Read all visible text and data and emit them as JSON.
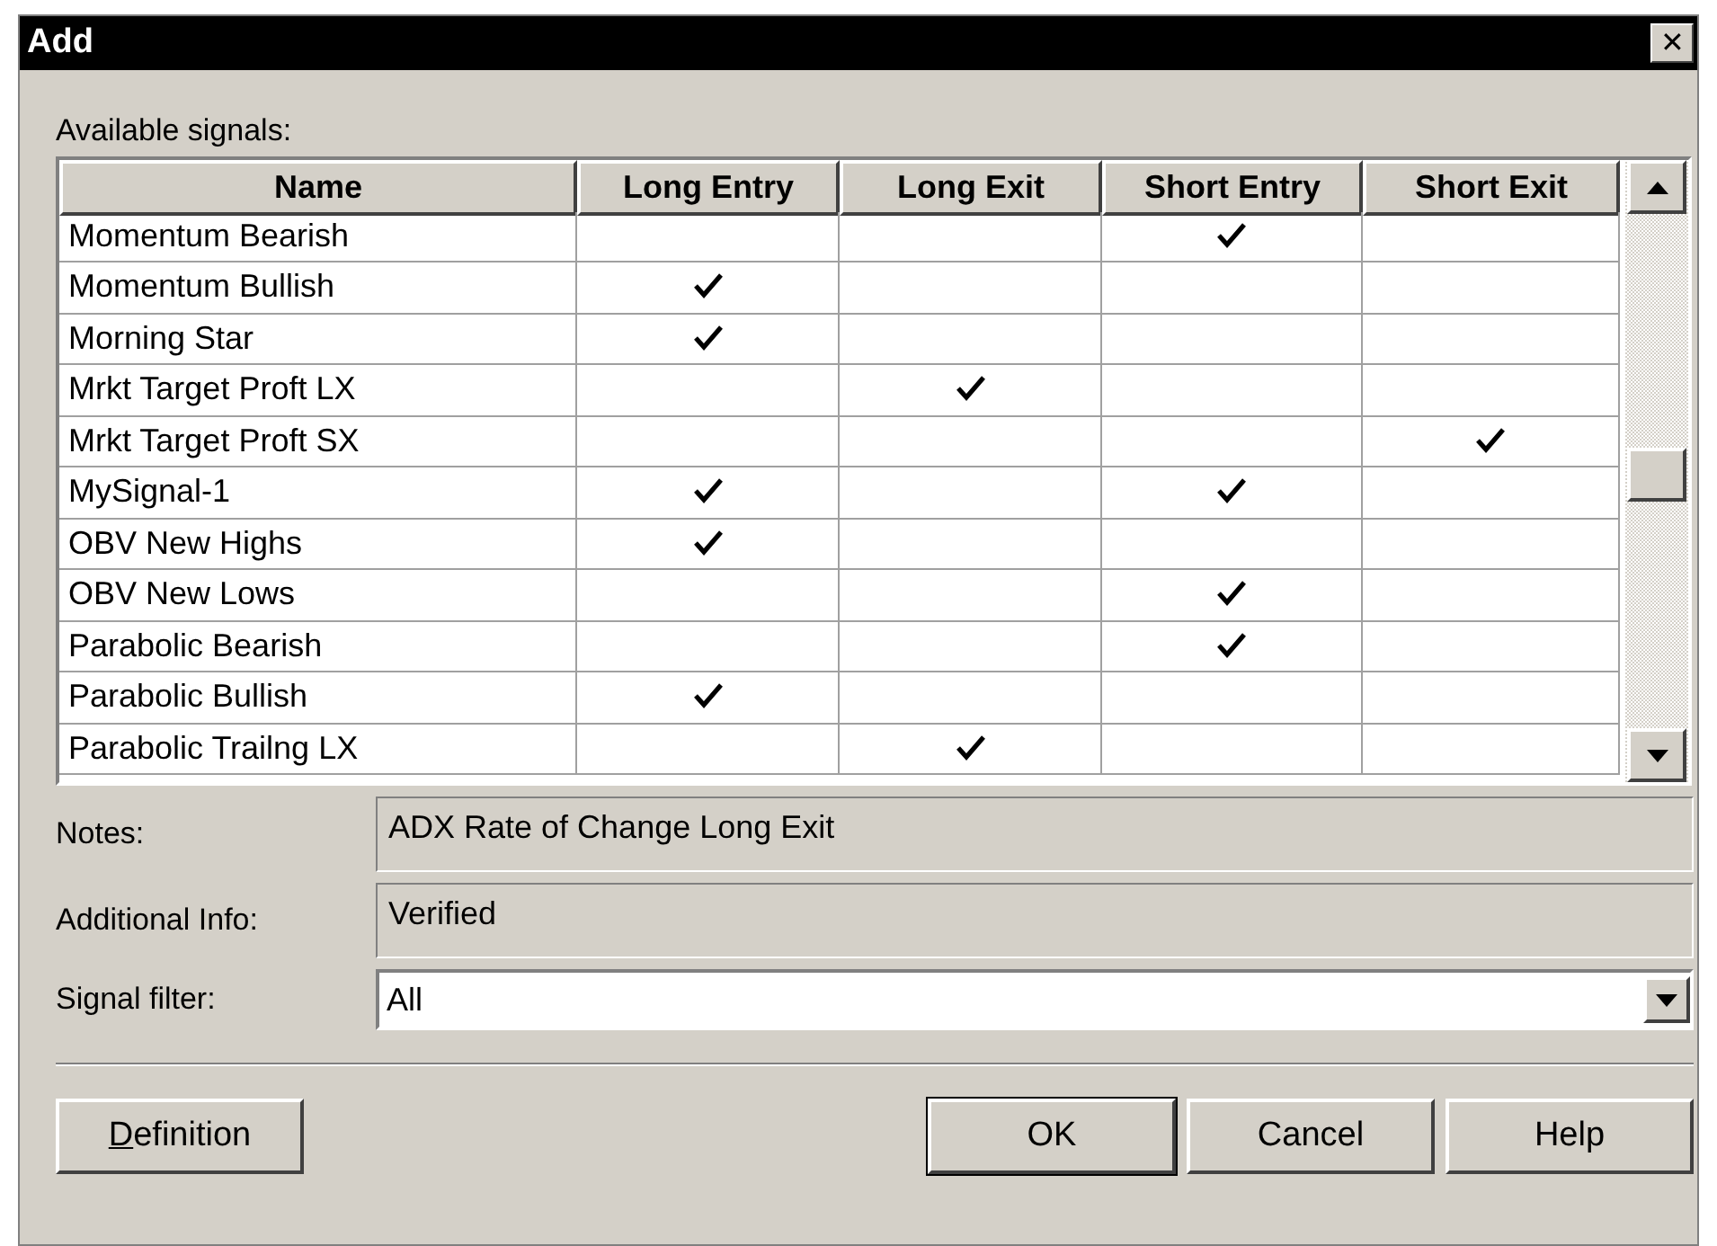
{
  "window": {
    "title": "Add",
    "close_glyph": "✕"
  },
  "signals": {
    "label": "Available signals:",
    "columns": [
      "Name",
      "Long Entry",
      "Long Exit",
      "Short Entry",
      "Short Exit"
    ],
    "rows": [
      {
        "name": "Momentum Bearish",
        "checks": [
          false,
          false,
          true,
          false
        ]
      },
      {
        "name": "Momentum Bullish",
        "checks": [
          true,
          false,
          false,
          false
        ]
      },
      {
        "name": "Morning Star",
        "checks": [
          true,
          false,
          false,
          false
        ]
      },
      {
        "name": "Mrkt Target Proft LX",
        "checks": [
          false,
          true,
          false,
          false
        ]
      },
      {
        "name": "Mrkt Target Proft SX",
        "checks": [
          false,
          false,
          false,
          true
        ]
      },
      {
        "name": "MySignal-1",
        "checks": [
          true,
          false,
          true,
          false
        ]
      },
      {
        "name": "OBV New Highs",
        "checks": [
          true,
          false,
          false,
          false
        ]
      },
      {
        "name": "OBV New Lows",
        "checks": [
          false,
          false,
          true,
          false
        ]
      },
      {
        "name": "Parabolic Bearish",
        "checks": [
          false,
          false,
          true,
          false
        ]
      },
      {
        "name": "Parabolic Bullish",
        "checks": [
          true,
          false,
          false,
          false
        ]
      },
      {
        "name": "Parabolic Trailng LX",
        "checks": [
          false,
          true,
          false,
          false
        ]
      }
    ]
  },
  "fields": [
    {
      "label": "Notes:",
      "value": "ADX Rate of Change Long Exit",
      "kind": "readonly"
    },
    {
      "label": "Additional Info:",
      "value": "Verified",
      "kind": "readonly"
    },
    {
      "label": "Signal filter:",
      "value": "All",
      "kind": "dropdown"
    }
  ],
  "buttons": [
    {
      "label": "Definition",
      "first_letter_underlined": true
    },
    {
      "label": "OK",
      "default": true
    },
    {
      "label": "Cancel"
    },
    {
      "label": "Help"
    }
  ]
}
